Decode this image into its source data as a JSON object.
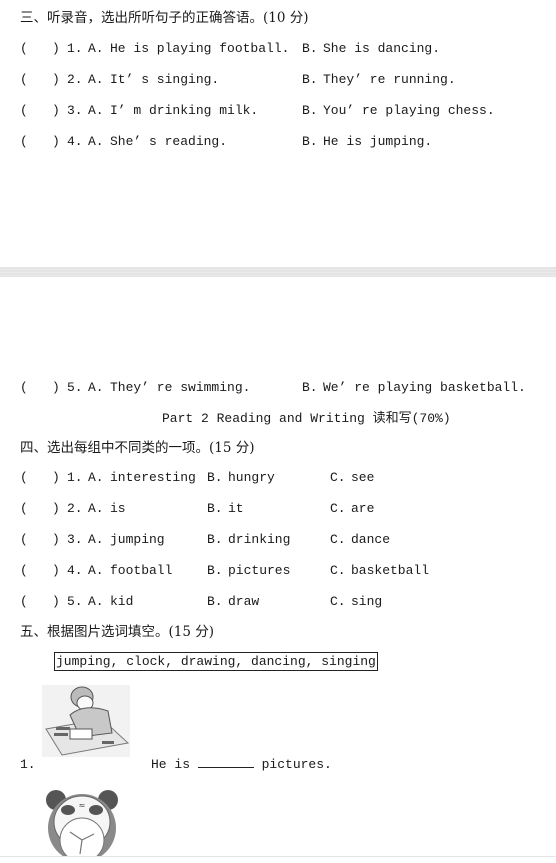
{
  "section3": {
    "title": "三、听录音，选出所听句子的正确答语。(10 分)",
    "items": [
      {
        "num": "1.",
        "a_label": "A.",
        "a": "He is playing football.",
        "b_label": "B.",
        "b": "She is dancing."
      },
      {
        "num": "2.",
        "a_label": "A.",
        "a": "It’ s singing.",
        "b_label": "B.",
        "b": "They’ re running."
      },
      {
        "num": "3.",
        "a_label": "A.",
        "a": "I’ m drinking milk.",
        "b_label": "B.",
        "b": "You’ re playing chess."
      },
      {
        "num": "4.",
        "a_label": "A.",
        "a": "She’ s reading.",
        "b_label": "B.",
        "b": "He is jumping."
      },
      {
        "num": "5.",
        "a_label": "A.",
        "a": "They’ re swimming.",
        "b_label": "B.",
        "b": "We’ re playing basketball."
      }
    ]
  },
  "paren_open": "(",
  "paren_close": ")",
  "part2_heading": "Part 2 Reading and Writing 读和写(70%)",
  "section4": {
    "title": "四、选出每组中不同类的一项。(15 分)",
    "items": [
      {
        "num": "1.",
        "a": "interesting",
        "b": "hungry",
        "c": "see"
      },
      {
        "num": "2.",
        "a": "is",
        "b": "it",
        "c": "are"
      },
      {
        "num": "3.",
        "a": "jumping",
        "b": "drinking",
        "c": "dance"
      },
      {
        "num": "4.",
        "a": "football",
        "b": "pictures",
        "c": "basketball"
      },
      {
        "num": "5.",
        "a": "kid",
        "b": "draw",
        "c": "sing"
      }
    ],
    "labels": {
      "a": "A.",
      "b": "B.",
      "c": "C."
    }
  },
  "section5": {
    "title": "五、根据图片选词填空。(15 分)",
    "word_bank": "jumping, clock, drawing, dancing, singing",
    "items": [
      {
        "num": "1.",
        "before": "He is ",
        "after": " pictures.",
        "image": "boy-drawing-illustration"
      },
      {
        "image": "panda-clock-illustration"
      }
    ]
  }
}
